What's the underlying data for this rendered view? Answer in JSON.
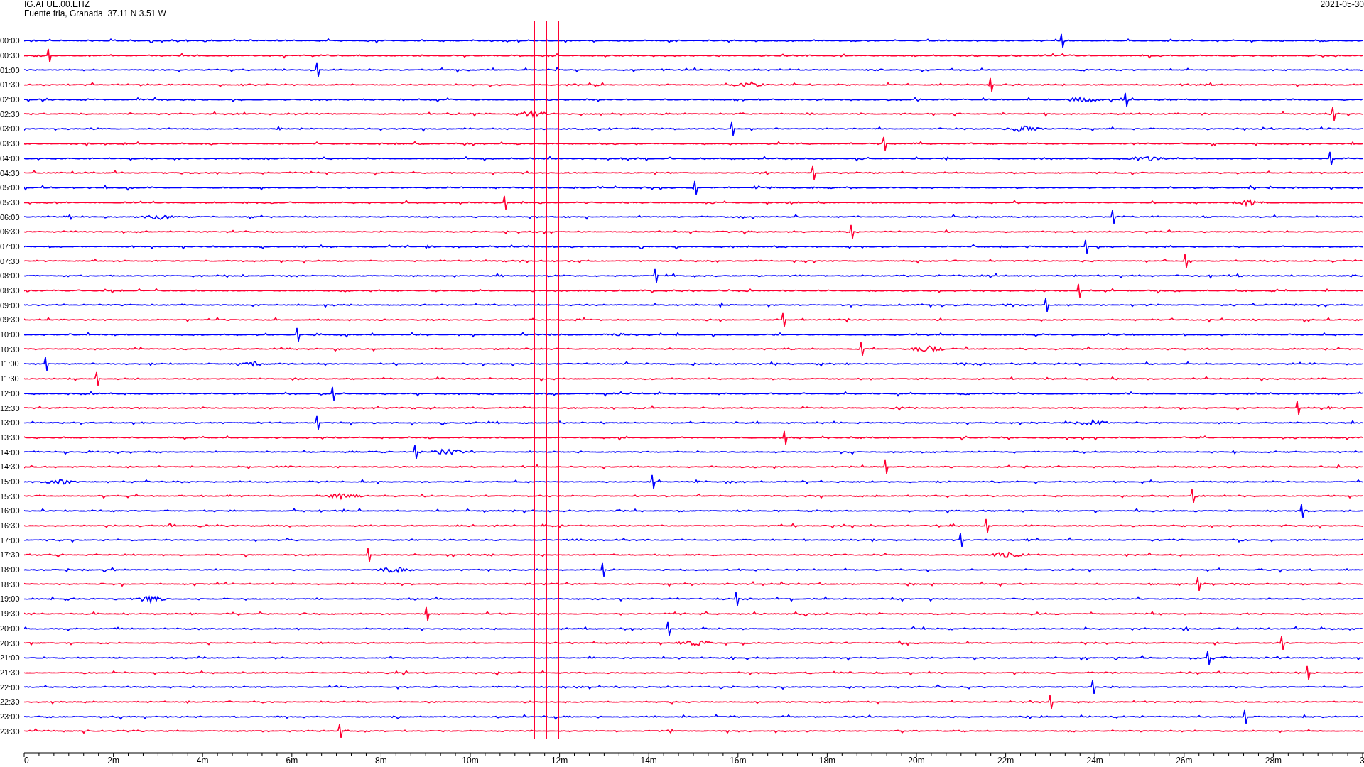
{
  "header": {
    "station": "IG.AFUE.00.EHZ",
    "location": "Fuente fria, Granada  37.11 N 3.51 W",
    "date": "2021-05-30"
  },
  "traces": [
    {
      "time": "00:00",
      "color": "#0000ff"
    },
    {
      "time": "00:30",
      "color": "#ff0033"
    },
    {
      "time": "01:00",
      "color": "#0000ff"
    },
    {
      "time": "01:30",
      "color": "#ff0033"
    },
    {
      "time": "02:00",
      "color": "#0000ff"
    },
    {
      "time": "02:30",
      "color": "#ff0033"
    },
    {
      "time": "03:00",
      "color": "#0000ff"
    },
    {
      "time": "03:30",
      "color": "#ff0033"
    },
    {
      "time": "04:00",
      "color": "#0000ff"
    },
    {
      "time": "04:30",
      "color": "#ff0033"
    },
    {
      "time": "05:00",
      "color": "#0000ff"
    },
    {
      "time": "05:30",
      "color": "#ff0033"
    },
    {
      "time": "06:00",
      "color": "#0000ff"
    },
    {
      "time": "06:30",
      "color": "#ff0033"
    },
    {
      "time": "07:00",
      "color": "#0000ff"
    },
    {
      "time": "07:30",
      "color": "#ff0033"
    },
    {
      "time": "08:00",
      "color": "#0000ff"
    },
    {
      "time": "08:30",
      "color": "#ff0033"
    },
    {
      "time": "09:00",
      "color": "#0000ff"
    },
    {
      "time": "09:30",
      "color": "#ff0033"
    },
    {
      "time": "10:00",
      "color": "#0000ff"
    },
    {
      "time": "10:30",
      "color": "#ff0033"
    },
    {
      "time": "11:00",
      "color": "#0000ff"
    },
    {
      "time": "11:30",
      "color": "#ff0033"
    },
    {
      "time": "12:00",
      "color": "#0000ff"
    },
    {
      "time": "12:30",
      "color": "#ff0033"
    },
    {
      "time": "13:00",
      "color": "#0000ff"
    },
    {
      "time": "13:30",
      "color": "#ff0033"
    },
    {
      "time": "14:00",
      "color": "#0000ff"
    },
    {
      "time": "14:30",
      "color": "#ff0033"
    },
    {
      "time": "15:00",
      "color": "#0000ff"
    },
    {
      "time": "15:30",
      "color": "#ff0033"
    },
    {
      "time": "16:00",
      "color": "#0000ff"
    },
    {
      "time": "16:30",
      "color": "#ff0033"
    },
    {
      "time": "17:00",
      "color": "#0000ff"
    },
    {
      "time": "17:30",
      "color": "#ff0033"
    },
    {
      "time": "18:00",
      "color": "#0000ff"
    },
    {
      "time": "18:30",
      "color": "#ff0033"
    },
    {
      "time": "19:00",
      "color": "#0000ff"
    },
    {
      "time": "19:30",
      "color": "#ff0033"
    },
    {
      "time": "20:00",
      "color": "#0000ff"
    },
    {
      "time": "20:30",
      "color": "#ff0033"
    },
    {
      "time": "21:00",
      "color": "#0000ff"
    },
    {
      "time": "21:30",
      "color": "#ff0033"
    },
    {
      "time": "22:00",
      "color": "#0000ff"
    },
    {
      "time": "22:30",
      "color": "#ff0033"
    },
    {
      "time": "23:00",
      "color": "#0000ff"
    },
    {
      "time": "23:30",
      "color": "#ff0033"
    }
  ],
  "time_axis": {
    "labels": [
      "0",
      "2m",
      "4m",
      "6m",
      "8m",
      "10m",
      "12m",
      "14m",
      "16m",
      "18m",
      "20m",
      "22m",
      "24m",
      "26m",
      "28m",
      "3"
    ]
  }
}
